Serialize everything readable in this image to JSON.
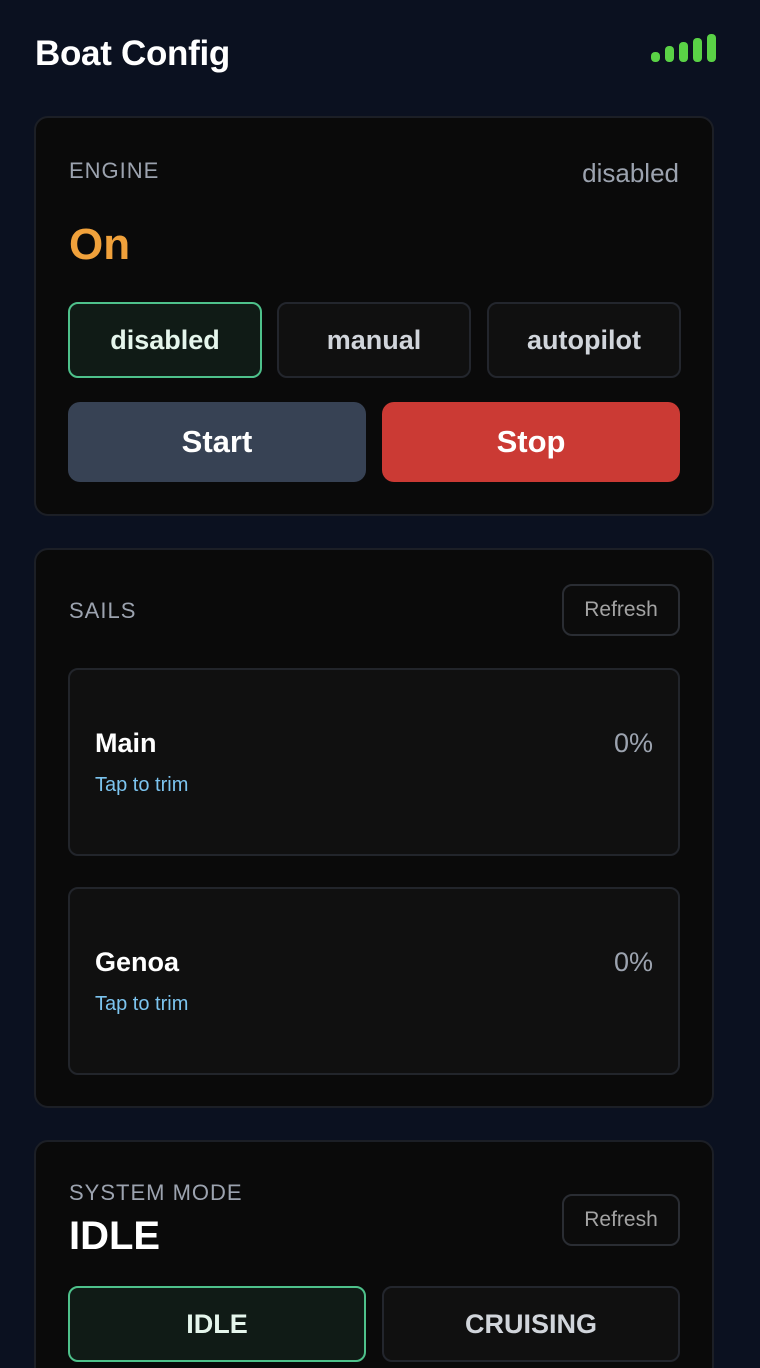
{
  "header": {
    "title": "Boat Config",
    "signal_icon": "signal-strength-icon",
    "signal_color": "#5ad246"
  },
  "engine": {
    "label": "ENGINE",
    "status": "disabled",
    "state": "On",
    "state_color": "#f0a13b",
    "modes": [
      {
        "label": "disabled",
        "active": true
      },
      {
        "label": "manual",
        "active": false
      },
      {
        "label": "autopilot",
        "active": false
      }
    ],
    "start_label": "Start",
    "stop_label": "Stop",
    "stop_color": "#cb3a34"
  },
  "sails": {
    "label": "SAILS",
    "refresh_label": "Refresh",
    "items": [
      {
        "name": "Main",
        "hint": "Tap to trim",
        "value": "0%"
      },
      {
        "name": "Genoa",
        "hint": "Tap to trim",
        "value": "0%"
      }
    ]
  },
  "system_mode": {
    "label": "SYSTEM MODE",
    "value": "IDLE",
    "refresh_label": "Refresh",
    "modes": [
      {
        "label": "IDLE",
        "active": true
      },
      {
        "label": "CRUISING",
        "active": false
      }
    ],
    "active_color": "#4ec18b"
  }
}
